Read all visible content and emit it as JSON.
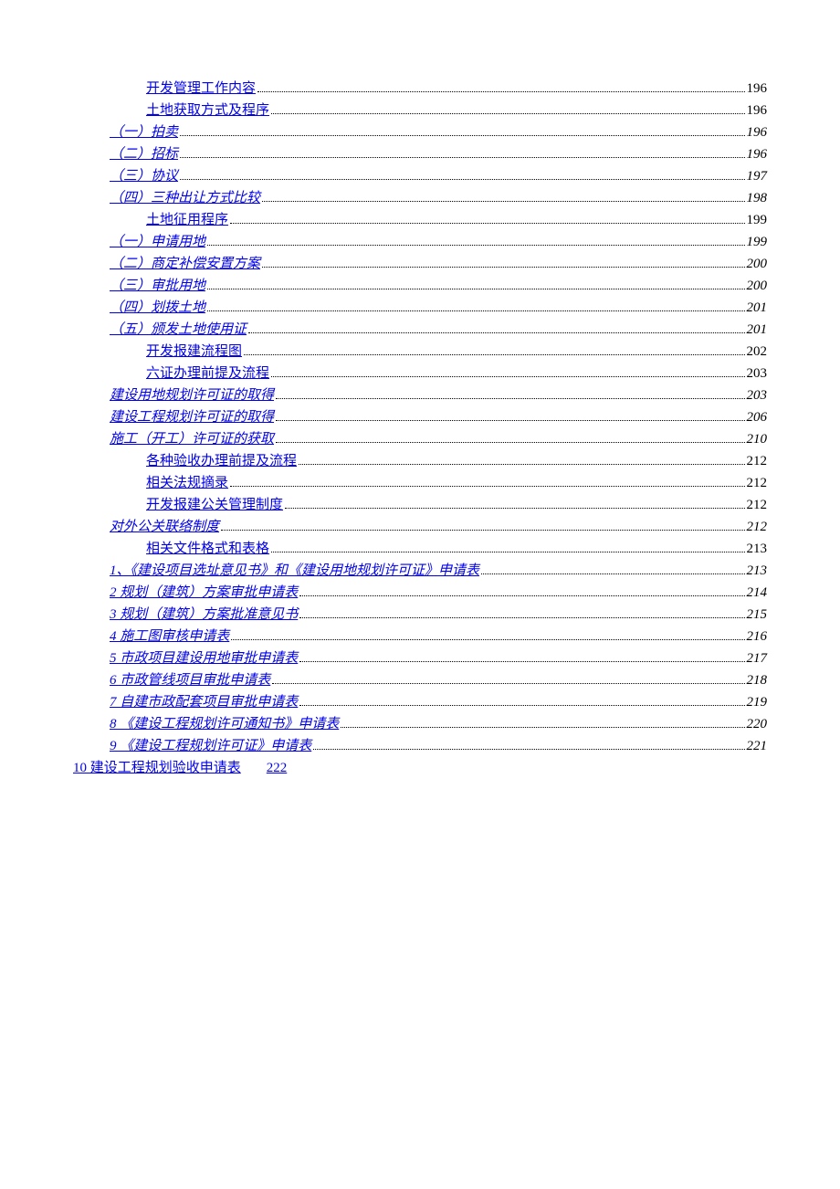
{
  "toc": [
    {
      "label": "开发管理工作内容",
      "page": "196",
      "indent": 2,
      "italic": false
    },
    {
      "label": "土地获取方式及程序",
      "page": "196",
      "indent": 2,
      "italic": false
    },
    {
      "label": "（一）拍卖",
      "page": "196",
      "indent": 1,
      "italic": true
    },
    {
      "label": "（二）招标",
      "page": "196",
      "indent": 1,
      "italic": true
    },
    {
      "label": "（三）协议",
      "page": "197",
      "indent": 1,
      "italic": true
    },
    {
      "label": "（四）三种出让方式比较",
      "page": "198",
      "indent": 1,
      "italic": true
    },
    {
      "label": "土地征用程序",
      "page": "199",
      "indent": 2,
      "italic": false
    },
    {
      "label": "（一）申请用地",
      "page": "199",
      "indent": 1,
      "italic": true
    },
    {
      "label": "（二）商定补偿安置方案",
      "page": "200",
      "indent": 1,
      "italic": true
    },
    {
      "label": "（三）审批用地",
      "page": "200",
      "indent": 1,
      "italic": true
    },
    {
      "label": "（四）划拨土地",
      "page": "201",
      "indent": 1,
      "italic": true
    },
    {
      "label": "（五）颁发土地使用证",
      "page": "201",
      "indent": 1,
      "italic": true
    },
    {
      "label": "开发报建流程图",
      "page": "202",
      "indent": 2,
      "italic": false
    },
    {
      "label": "六证办理前提及流程",
      "page": "203",
      "indent": 2,
      "italic": false
    },
    {
      "label": "建设用地规划许可证的取得",
      "page": "203",
      "indent": 1,
      "italic": true
    },
    {
      "label": "建设工程规划许可证的取得",
      "page": "206",
      "indent": 1,
      "italic": true
    },
    {
      "label": "施工（开工）许可证的获取",
      "page": "210",
      "indent": 1,
      "italic": true
    },
    {
      "label": "各种验收办理前提及流程",
      "page": "212",
      "indent": 2,
      "italic": false
    },
    {
      "label": "相关法规摘录",
      "page": "212",
      "indent": 2,
      "italic": false
    },
    {
      "label": "开发报建公关管理制度",
      "page": "212",
      "indent": 2,
      "italic": false
    },
    {
      "label": "对外公关联络制度",
      "page": "212",
      "indent": 1,
      "italic": true
    },
    {
      "label": "相关文件格式和表格",
      "page": "213",
      "indent": 2,
      "italic": false
    },
    {
      "label": "1、《建设项目选址意见书》和《建设用地规划许可证》申请表",
      "page": "213",
      "indent": 1,
      "italic": true
    },
    {
      "label": "2 规划（建筑）方案审批申请表",
      "page": "214",
      "indent": 1,
      "italic": true
    },
    {
      "label": "3 规划（建筑）方案批准意见书",
      "page": "215",
      "indent": 1,
      "italic": true
    },
    {
      "label": "4 施工图审核申请表",
      "page": "216",
      "indent": 1,
      "italic": true
    },
    {
      "label": "5 市政项目建设用地审批申请表",
      "page": "217",
      "indent": 1,
      "italic": true
    },
    {
      "label": "6 市政管线项目审批申请表",
      "page": "218",
      "indent": 1,
      "italic": true
    },
    {
      "label": "7 自建市政配套项目审批申请表",
      "page": "219",
      "indent": 1,
      "italic": true
    },
    {
      "label": "8 《建设工程规划许可通知书》申请表",
      "page": "220",
      "indent": 1,
      "italic": true
    },
    {
      "label": "9 《建设工程规划许可证》申请表",
      "page": "221",
      "indent": 1,
      "italic": true
    }
  ],
  "final": {
    "label": "10 建设工程规划验收申请表",
    "page": "222"
  }
}
